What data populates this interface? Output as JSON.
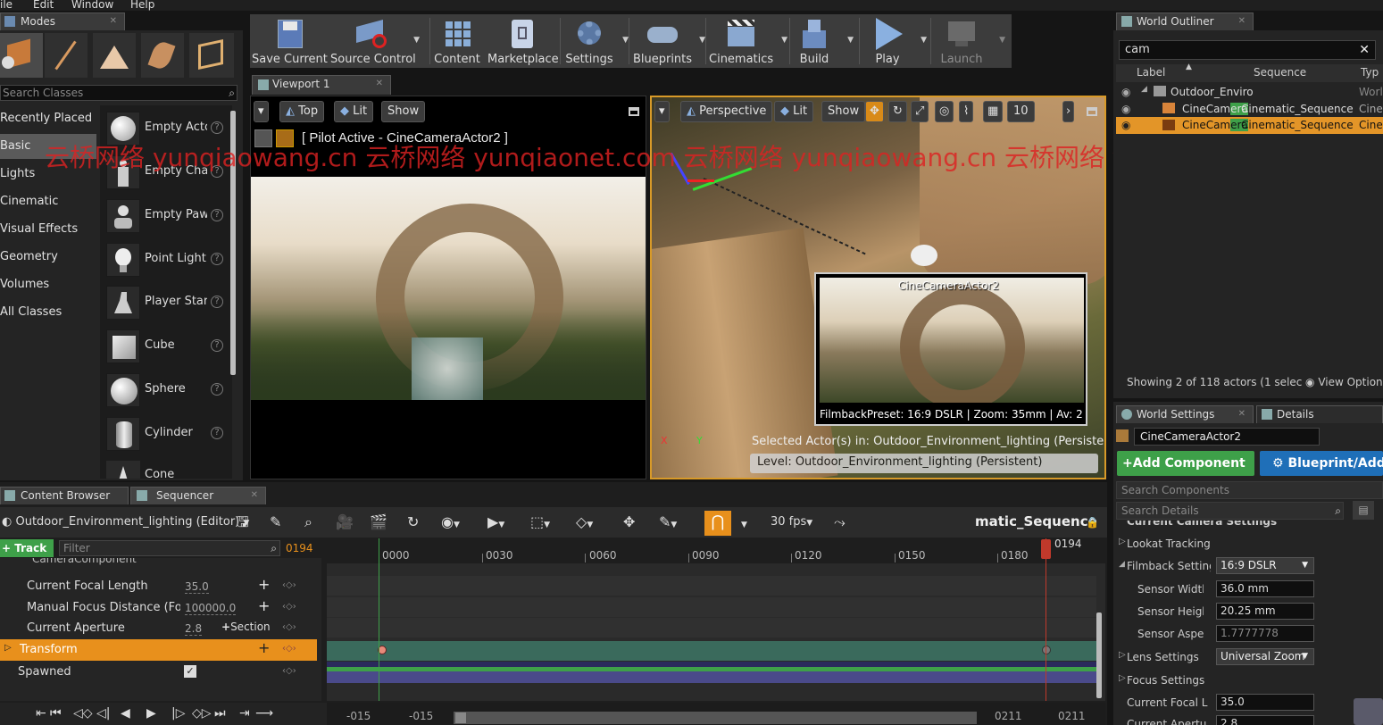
{
  "menu": [
    "ile",
    "Edit",
    "Window",
    "Help"
  ],
  "modes_panel": {
    "tab_label": "Modes",
    "search_placeholder": "Search Classes",
    "categories": [
      "Recently Placed",
      "Basic",
      "Lights",
      "Cinematic",
      "Visual Effects",
      "Geometry",
      "Volumes",
      "All Classes"
    ],
    "selected_category": "Basic",
    "items": [
      "Empty Actc",
      "Empty Cha",
      "Empty Paw",
      "Point Light",
      "Player Star",
      "Cube",
      "Sphere",
      "Cylinder",
      "Cone"
    ]
  },
  "toolbar": {
    "buttons": [
      "Save Current",
      "Source Control",
      "Content",
      "Marketplace",
      "Settings",
      "Blueprints",
      "Cinematics",
      "Build",
      "Play",
      "Launch"
    ]
  },
  "viewport_tab": "Viewport 1",
  "left_viewport": {
    "view_label": "Top",
    "lit_label": "Lit",
    "show_label": "Show",
    "pilot_text": "[ Pilot Active - CineCameraActor2 ]"
  },
  "right_viewport": {
    "view_label": "Perspective",
    "lit_label": "Lit",
    "show_label": "Show",
    "grid_value": "10",
    "camera_label": "CineCameraActor2",
    "camera_info": "FilmbackPreset: 16:9 DSLR | Zoom: 35mm | Av: 2",
    "selected_actors": "Selected Actor(s) in:  Outdoor_Environment_lighting (Persistent)",
    "level_text": "Level:  Outdoor_Environment_lighting (Persistent)",
    "axis_x": "X",
    "axis_y": "Y"
  },
  "watermark": "云桥网络 yunqiaowang.cn 云桥网络 yunqiaonet.com 云桥网络 yunqiaowang.cn 云桥网络 yunqiaonet.com",
  "world_outliner": {
    "tab_label": "World Outliner",
    "search_value": "cam",
    "columns": [
      "Label",
      "Sequence",
      "Typ"
    ],
    "rows": [
      {
        "label": "Outdoor_Enviro",
        "sequence": "",
        "type": "Worl"
      },
      {
        "label_pre": "CineCam",
        "label_hl": "era",
        "sequence": "Cinematic_Sequence",
        "type": "Cine"
      },
      {
        "label_pre": "CineCam",
        "label_hl": "era",
        "sequence": "Cinematic_Sequence",
        "type": "Cine"
      }
    ],
    "status": "Showing 2 of 118 actors (1 selec",
    "view_options": "View Option"
  },
  "details": {
    "tab_world_settings": "World Settings",
    "tab_details": "Details",
    "actor_name": "CineCameraActor2",
    "add_component": "+Add Component",
    "blueprint_add": "Blueprint/Add",
    "search_components": "Search Components",
    "search_details": "Search Details",
    "section": "Current Camera Settings",
    "rows": [
      {
        "label": "Lookat Tracking",
        "value": ""
      },
      {
        "label": "Filmback Setting",
        "value": "16:9 DSLR"
      },
      {
        "label": "Sensor Width",
        "value": "36.0 mm"
      },
      {
        "label": "Sensor Heigh",
        "value": "20.25 mm"
      },
      {
        "label": "Sensor Aspe",
        "value": "1.7777778"
      },
      {
        "label": "Lens Settings",
        "value": "Universal Zoom"
      },
      {
        "label": "Focus Settings",
        "value": ""
      },
      {
        "label": "Current Focal L",
        "value": "35.0"
      },
      {
        "label": "Current Apertu",
        "value": "2.8"
      }
    ]
  },
  "bottom_tabs": [
    "Content Browser",
    "Sequencer"
  ],
  "sequencer": {
    "level_label": "Outdoor_Environment_lighting (Editor)",
    "fps": "30 fps",
    "sequence_name": "matic_Sequence",
    "track_button": "+ Track",
    "filter_placeholder": "Filter",
    "current_frame": "0194",
    "component_row": "CameraComponent",
    "tracks": [
      {
        "label": "Current Focal Length",
        "value": "35.0"
      },
      {
        "label": "Manual Focus Distance (Focu",
        "value": "100000.0"
      },
      {
        "label": "Current Aperture",
        "value": "2.8",
        "extra": "Section"
      }
    ],
    "transform_label": "Transform",
    "spawned_label": "Spawned",
    "ticks": [
      "0000",
      "0030",
      "0060",
      "0090",
      "0120",
      "0150",
      "0180"
    ],
    "playhead_label": "0194",
    "range_start_a": "-015",
    "range_start_b": "-015",
    "range_end_a": "0211",
    "range_end_b": "0211"
  },
  "colors": {
    "accent_orange": "#e8901c",
    "selection_green": "#3ea049",
    "blueprint_blue": "#1f6fb8"
  }
}
